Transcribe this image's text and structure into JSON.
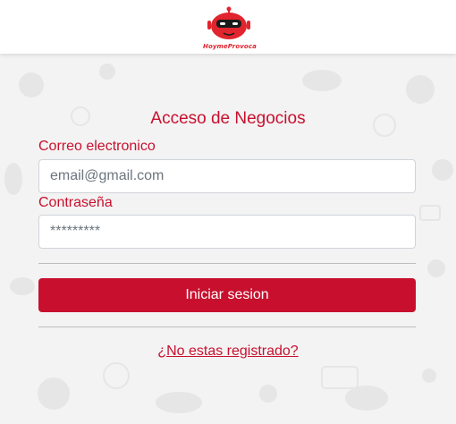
{
  "brand": {
    "logo_text": "HoymeProvoca",
    "accent_color": "#c8102e"
  },
  "form": {
    "title": "Acceso de Negocios",
    "email_label": "Correo electronico",
    "email_placeholder": "email@gmail.com",
    "email_value": "",
    "password_label": "Contraseña",
    "password_placeholder": "*********",
    "password_value": "",
    "submit_label": "Iniciar sesion",
    "register_link": "¿No estas registrado?"
  }
}
